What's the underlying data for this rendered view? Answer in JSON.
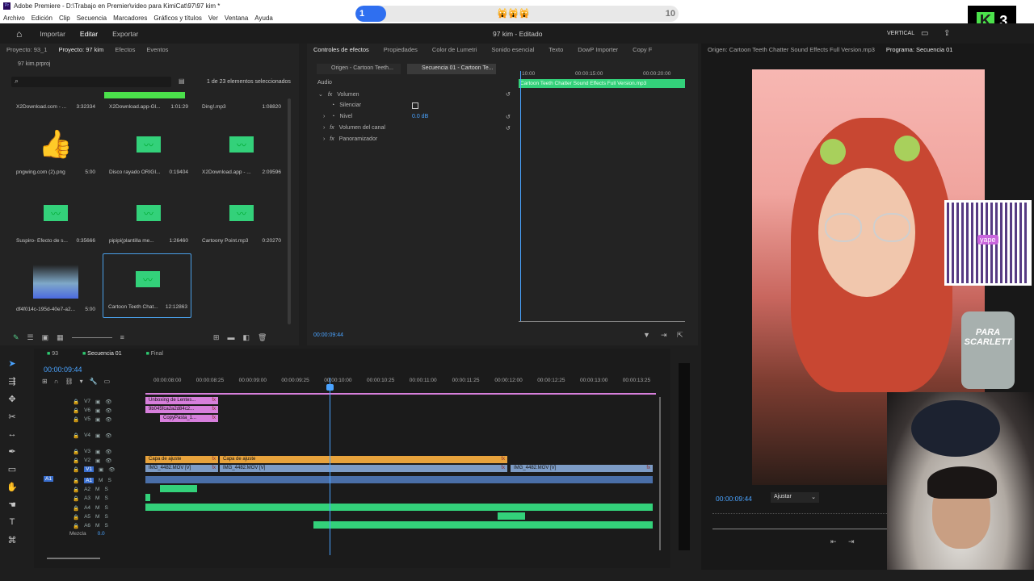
{
  "window": {
    "title": "Adobe Premiere - D:\\Trabajo en Premier\\video para KimiCat\\97\\97 kim *"
  },
  "menu": [
    "Archivo",
    "Edición",
    "Clip",
    "Secuencia",
    "Marcadores",
    "Gráficos y títulos",
    "Ver",
    "Ventana",
    "Ayuda"
  ],
  "overlay": {
    "progress_start": "1",
    "progress_end": "10",
    "progress_fraction": 0.06,
    "emojis": "🙀🙀🙀",
    "badge_number": "3",
    "badge_letter": "K"
  },
  "header": {
    "tabs": [
      "Importar",
      "Editar",
      "Exportar"
    ],
    "active_tab": "Editar",
    "center_title": "97 kim - Editado",
    "vertical_label": "VERTICAL"
  },
  "project": {
    "tabs": [
      "Proyecto: 93_1",
      "Proyecto: 97 kim",
      "Efectos",
      "Eventos"
    ],
    "file": "97 kim.prproj",
    "selection_info": "1 de 23 elementos seleccionados",
    "items": [
      {
        "name": "X2Download.com - ...",
        "duration": "3:32334",
        "kind": "video"
      },
      {
        "name": "X2Download.app-Gl...",
        "duration": "1:01:29",
        "kind": "bar"
      },
      {
        "name": "Ding!.mp3",
        "duration": "1:08820",
        "kind": "none"
      },
      {
        "name": "pngwing.com (2).png",
        "duration": "5:00",
        "kind": "emoji"
      },
      {
        "name": "Disco rayado ORIGI...",
        "duration": "0:19404",
        "kind": "audio"
      },
      {
        "name": "X2Download.app - ...",
        "duration": "2:09596",
        "kind": "audio"
      },
      {
        "name": "Suspiro- Efecto de s...",
        "duration": "0:35666",
        "kind": "audio"
      },
      {
        "name": "pipipi(plantilla me...",
        "duration": "1:26460",
        "kind": "audio"
      },
      {
        "name": "Cartoony Point.mp3",
        "duration": "0:20270",
        "kind": "audio"
      },
      {
        "name": "df4f014c-195d-40e7-a2...",
        "duration": "5:00",
        "kind": "thumb"
      },
      {
        "name": "Cartoon Teeth Chat...",
        "duration": "12:12863",
        "kind": "audio-selected"
      }
    ]
  },
  "effects": {
    "tabs": [
      "Controles de efectos",
      "Propiedades",
      "Color de Lumetri",
      "Sonido esencial",
      "Texto",
      "DowP Importer",
      "Copy F"
    ],
    "source_tab": "Origen - Cartoon Teeth...",
    "sequence_tab": "Secuencia 01 - Cartoon Te...",
    "section": "Audio",
    "rows": [
      {
        "label": "Volumen",
        "value": ""
      },
      {
        "label": "Silenciar",
        "value": ""
      },
      {
        "label": "Nivel",
        "value": "0.0 dB"
      },
      {
        "label": "Volumen del canal",
        "value": ""
      },
      {
        "label": "Panoramizador",
        "value": ""
      }
    ],
    "ruler": [
      "10:00",
      "00:00:15:00",
      "00:00:20:00"
    ],
    "clip_name": "Cartoon Teeth Chatter Sound Effects Full Version.mp3",
    "timecode": "00:00:09:44"
  },
  "source_monitor": {
    "title": "Origen: Cartoon Teeth Chatter Sound Effects Full Version.mp3",
    "program_title": "Programa: Secuencia 01"
  },
  "program": {
    "timecode": "00:00:09:44",
    "fit": "Ajustar"
  },
  "video_overlay": {
    "sticker_line1": "PARA",
    "sticker_line2": "SCARLETT",
    "qr_label": "yape"
  },
  "timeline": {
    "tabs": [
      "93",
      "Secuencia 01",
      "Final"
    ],
    "timecode": "00:00:09:44",
    "ruler": [
      "00:00:08:00",
      "00:00:08:25",
      "00:00:09:00",
      "00:00:09:25",
      "00:00:10:00",
      "00:00:10:25",
      "00:00:11:00",
      "00:00:11:25",
      "00:00:12:00",
      "00:00:12:25",
      "00:00:13:00",
      "00:00:13:25"
    ],
    "tracks": [
      "V7",
      "V6",
      "V5",
      "V4",
      "V3",
      "V2",
      "V1",
      "A1",
      "A2",
      "A3",
      "A4",
      "A5",
      "A6"
    ],
    "a1_source": "A1",
    "mix_label": "Mezcla",
    "mix_value": "0.0",
    "clips": {
      "v7": "Unboxing de Lentes...",
      "v6": "9b045fca2a2d84c2...",
      "v5": "CopyPasta_1...",
      "v2a": "Capa de ajuste",
      "v2b": "Capa de ajuste",
      "v1a": "IMG_4482.MOV [V]",
      "v1b": "IMG_4482.MOV [V]",
      "v1c": "IMG_4482.MOV [V]",
      "fx": "fx"
    }
  },
  "colors": {
    "accent": "#2d8ceb",
    "audio_green": "#33d17a",
    "clip_pink": "#d77fdc",
    "clip_orange": "#e8a33c",
    "clip_blue": "#7d9cc6"
  }
}
